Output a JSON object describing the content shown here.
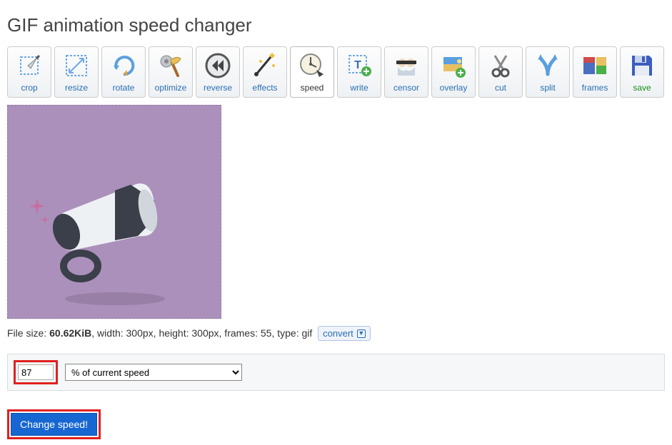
{
  "page_title": "GIF animation speed changer",
  "toolbar": [
    {
      "id": "crop",
      "label": "crop"
    },
    {
      "id": "resize",
      "label": "resize"
    },
    {
      "id": "rotate",
      "label": "rotate"
    },
    {
      "id": "optimize",
      "label": "optimize"
    },
    {
      "id": "reverse",
      "label": "reverse"
    },
    {
      "id": "effects",
      "label": "effects"
    },
    {
      "id": "speed",
      "label": "speed",
      "active": true
    },
    {
      "id": "write",
      "label": "write"
    },
    {
      "id": "censor",
      "label": "censor"
    },
    {
      "id": "overlay",
      "label": "overlay"
    },
    {
      "id": "cut",
      "label": "cut"
    },
    {
      "id": "split",
      "label": "split"
    },
    {
      "id": "frames",
      "label": "frames"
    },
    {
      "id": "save",
      "label": "save"
    }
  ],
  "file_info": {
    "size_label": "File size: ",
    "size_value": "60.62KiB",
    "width_label": ", width: 300px",
    "height_label": ", height: 300px",
    "frames_label": ", frames: 55",
    "type_label": ", type: gif"
  },
  "convert_label": "convert",
  "speed_form": {
    "value": "87",
    "mode_selected": "% of current speed"
  },
  "submit_label": "Change speed!"
}
